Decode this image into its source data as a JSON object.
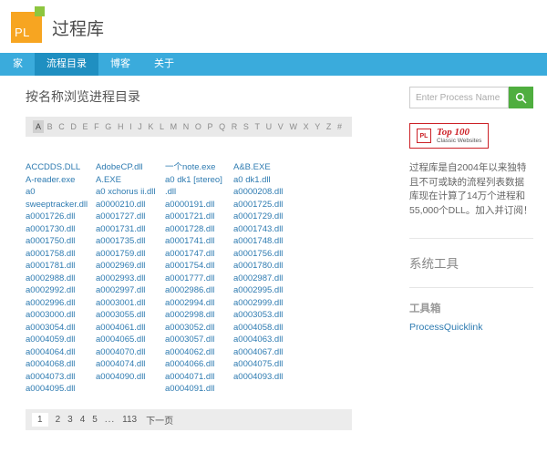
{
  "colors": {
    "nav": "#3aabdc",
    "nav_active": "#1f8fc1",
    "link": "#2e7bb1",
    "search_button": "#4fae3f",
    "logo_orange": "#f7a521",
    "logo_green": "#8dc63f",
    "badge_red": "#cc2127"
  },
  "header": {
    "logo_text": "PL",
    "title": "过程库"
  },
  "nav": {
    "items": [
      {
        "id": "home",
        "label": "家",
        "active": false
      },
      {
        "id": "directory",
        "label": "流程目录",
        "active": true
      },
      {
        "id": "blog",
        "label": "博客",
        "active": false
      },
      {
        "id": "about",
        "label": "关于",
        "active": false
      }
    ]
  },
  "main": {
    "heading": "按名称浏览进程目录",
    "alphabet": [
      "A",
      "B",
      "C",
      "D",
      "E",
      "F",
      "G",
      "H",
      "I",
      "J",
      "K",
      "L",
      "M",
      "N",
      "O",
      "P",
      "Q",
      "R",
      "S",
      "T",
      "U",
      "V",
      "W",
      "X",
      "Y",
      "Z",
      "#"
    ],
    "active_letter": "A",
    "columns": [
      [
        "ACCDDS.DLL",
        "A-reader.exe",
        "a0 sweeptracker.dll",
        "a0001726.dll",
        "a0001730.dll",
        "a0001750.dll",
        "a0001758.dll",
        "a0001781.dll",
        "a0002988.dll",
        "a0002992.dll",
        "a0002996.dll",
        "a0003000.dll",
        "a0003054.dll",
        "a0004059.dll",
        "a0004064.dll",
        "a0004068.dll",
        "a0004073.dll",
        "a0004095.dll"
      ],
      [
        "AdobeCP.dll",
        "A.EXE",
        "a0 xchorus ii.dll",
        "a0000210.dll",
        "a0001727.dll",
        "a0001731.dll",
        "a0001735.dll",
        "a0001759.dll",
        "a0002969.dll",
        "a0002993.dll",
        "a0002997.dll",
        "a0003001.dll",
        "a0003055.dll",
        "a0004061.dll",
        "a0004065.dll",
        "a0004070.dll",
        "a0004074.dll",
        "a0004090.dll"
      ],
      [
        "一个note.exe",
        "a0 dk1 [stereo] .dll",
        "a0000191.dll",
        "a0001721.dll",
        "a0001728.dll",
        "a0001741.dll",
        "a0001747.dll",
        "a0001754.dll",
        "a0001777.dll",
        "a0002986.dll",
        "a0002994.dll",
        "a0002998.dll",
        "a0003052.dll",
        "a0003057.dll",
        "a0004062.dll",
        "a0004066.dll",
        "a0004071.dll",
        "a0004091.dll"
      ],
      [
        "A&B.EXE",
        "a0 dk1.dll",
        "a0000208.dll",
        "a0001725.dll",
        "a0001729.dll",
        "a0001743.dll",
        "a0001748.dll",
        "a0001756.dll",
        "a0001780.dll",
        "a0002987.dll",
        "a0002995.dll",
        "a0002999.dll",
        "a0003053.dll",
        "a0004058.dll",
        "a0004063.dll",
        "a0004067.dll",
        "a0004075.dll",
        "a0004093.dll"
      ]
    ],
    "pagination": {
      "pages": [
        "1",
        "2",
        "3",
        "4",
        "5",
        "...",
        "113"
      ],
      "current": "1",
      "next_label": "下一页"
    }
  },
  "sidebar": {
    "search": {
      "placeholder": "Enter Process Name"
    },
    "badge": {
      "logo_text": "PL",
      "title": "Top 100",
      "subtitle": "Classic Websites"
    },
    "description": "过程库是自2004年以来独特且不可或缺的流程列表数据库现在计算了14万个进程和55,000个DLL。加入并订阅！",
    "sections": [
      {
        "title": "系统工具",
        "links": []
      },
      {
        "title": "工具箱",
        "links": [
          "ProcessQuicklink"
        ]
      }
    ]
  }
}
